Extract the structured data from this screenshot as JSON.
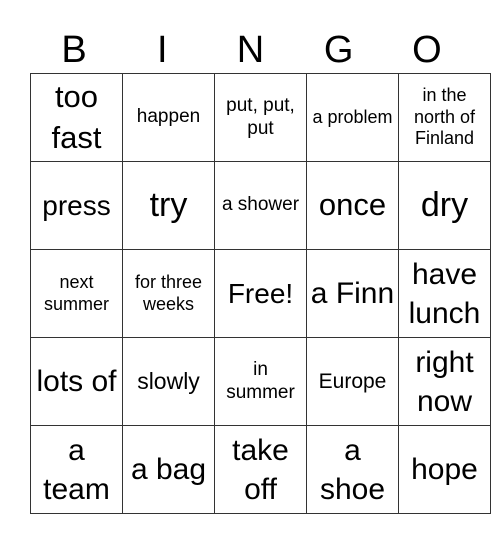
{
  "header": [
    "B",
    "I",
    "N",
    "G",
    "O"
  ],
  "cells": [
    [
      "too fast",
      "happen",
      "put, put, put",
      "a problem",
      "in the north of Finland"
    ],
    [
      "press",
      "try",
      "a shower",
      "once",
      "dry"
    ],
    [
      "next summer",
      "for three weeks",
      "Free!",
      "a Finn",
      "have lunch"
    ],
    [
      "lots of",
      "slowly",
      "in summer",
      "Europe",
      "right now"
    ],
    [
      "a team",
      "a bag",
      "take off",
      "a shoe",
      "hope"
    ]
  ]
}
